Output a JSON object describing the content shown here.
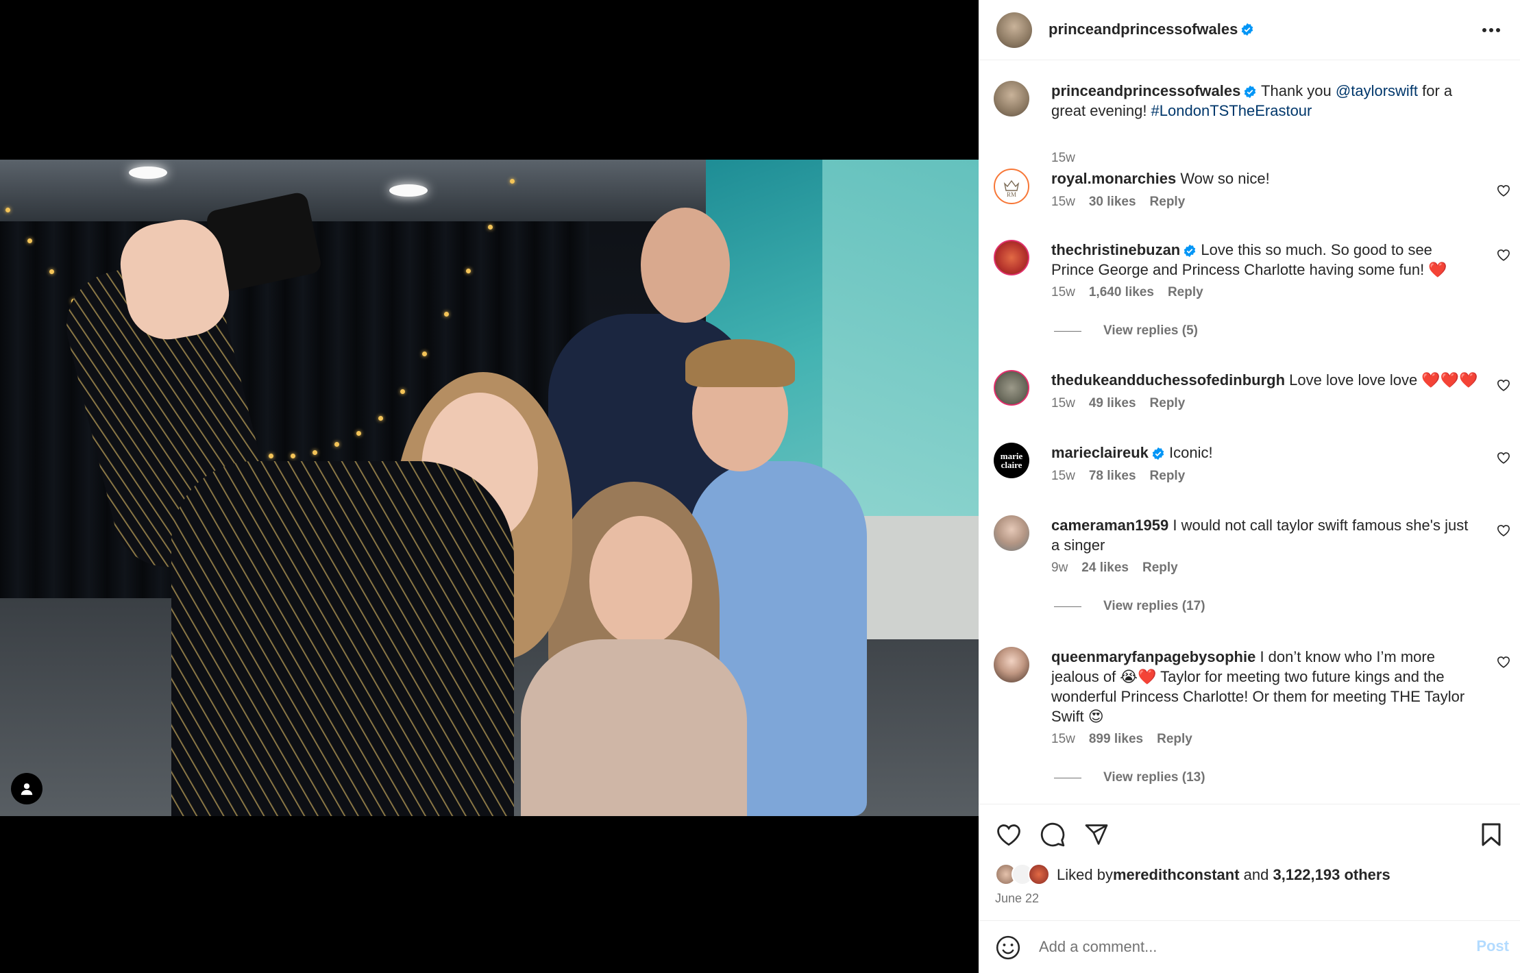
{
  "post": {
    "username": "princeandprincessofwales",
    "caption_pre": "Thank you ",
    "caption_mention": "@taylorswift",
    "caption_mid": " for a great evening! ",
    "caption_hashtag": "#LondonTSTheErastour",
    "age": "15w"
  },
  "comments": [
    {
      "username": "royal.monarchies",
      "verified": false,
      "text": "Wow so nice!",
      "age": "15w",
      "likes": "30 likes",
      "reply": "Reply",
      "avatar_icon": "crown-monogram"
    },
    {
      "username": "thechristinebuzan",
      "verified": true,
      "text": "Love this so much. So good to see Prince George and Princess Charlotte having some fun! ❤️",
      "age": "15w",
      "likes": "1,640 likes",
      "reply": "Reply",
      "view_replies": "View replies (5)"
    },
    {
      "username": "thedukeandduchessofedinburgh",
      "verified": false,
      "text": "Love love love love ❤️❤️❤️",
      "age": "15w",
      "likes": "49 likes",
      "reply": "Reply"
    },
    {
      "username": "marieclaireuk",
      "verified": true,
      "text": "Iconic!",
      "age": "15w",
      "likes": "78 likes",
      "reply": "Reply",
      "avatar_text": "marie claire"
    },
    {
      "username": "cameraman1959",
      "verified": false,
      "text": "I would not call taylor swift famous she's just a singer",
      "age": "9w",
      "likes": "24 likes",
      "reply": "Reply",
      "view_replies": "View replies (17)"
    },
    {
      "username": "queenmaryfanpagebysophie",
      "verified": false,
      "text": "I don’t know who I’m more jealous of 😭❤️ Taylor for meeting two future kings and the wonderful Princess Charlotte! Or them for meeting THE Taylor Swift 😍",
      "age": "15w",
      "likes": "899 likes",
      "reply": "Reply",
      "view_replies": "View replies (13)"
    }
  ],
  "likes": {
    "prefix": "Liked by ",
    "user": "meredithconstant",
    "and": " and ",
    "others": "3,122,193 others"
  },
  "date": "June 22",
  "add_comment": {
    "placeholder": "Add a comment...",
    "post_label": "Post"
  },
  "colors": {
    "link": "#00376b",
    "verified": "#0095f6",
    "muted": "#737373",
    "post_disabled": "#b3dbff"
  }
}
